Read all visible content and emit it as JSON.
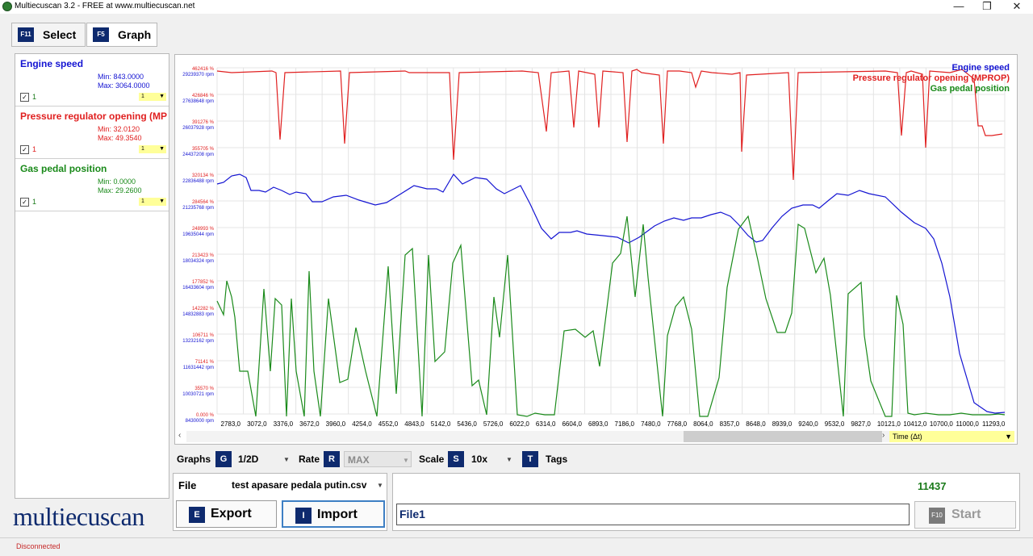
{
  "window": {
    "title": "Multiecuscan 3.2 - FREE at www.multiecuscan.net",
    "minimize": "—",
    "maximize": "❐",
    "close": "✕"
  },
  "tabs": [
    {
      "key": "F11",
      "label": "Select"
    },
    {
      "key": "F5",
      "label": "Graph"
    }
  ],
  "signals": [
    {
      "name": "Engine speed",
      "min": "Min: 843.0000",
      "max": "Max: 3064.0000",
      "checked": "✓",
      "count": "1",
      "sel": "1",
      "color": "#1414d2"
    },
    {
      "name": "Pressure regulator opening (MPROP)",
      "min": "Min: 32.0120",
      "max": "Max: 49.3540",
      "checked": "✓",
      "count": "1",
      "sel": "1",
      "color": "#e02020"
    },
    {
      "name": "Gas pedal position",
      "min": "Min: 0.0000",
      "max": "Max: 29.2600",
      "checked": "✓",
      "count": "1",
      "sel": "1",
      "color": "#1a8a1a"
    }
  ],
  "graph": {
    "legend": [
      "Engine speed",
      "Pressure regulator opening (MPROP)",
      "Gas pedal position"
    ],
    "y_red": [
      "462416 %",
      "426846 %",
      "391276 %",
      "355705 %",
      "320134 %",
      "284564 %",
      "248993 %",
      "213423 %",
      "177852 %",
      "142282 %",
      "106711 %",
      "71141 %",
      "35570 %",
      "0.000 %"
    ],
    "y_blue": [
      "29239370 rpm",
      "27638648 rpm",
      "26037928 rpm",
      "24437208 rpm",
      "22836488 rpm",
      "21235768 rpm",
      "19635044 rpm",
      "18034324 rpm",
      "16433604 rpm",
      "14832883 rpm",
      "13232162 rpm",
      "11631442 rpm",
      "10030721 rpm",
      "8430000 rpm"
    ],
    "x_ticks": [
      "2783,0",
      "3072,0",
      "3376,0",
      "3672,0",
      "3960,0",
      "4254,0",
      "4552,0",
      "4843,0",
      "5142,0",
      "5436,0",
      "5726,0",
      "6022,0",
      "6314,0",
      "6604,0",
      "6893,0",
      "7186,0",
      "7480,0",
      "7768,0",
      "8064,0",
      "8357,0",
      "8648,0",
      "8939,0",
      "9240,0",
      "9532,0",
      "9827,0",
      "10121,0",
      "10412,0",
      "10700,0",
      "11000,0",
      "11293,0"
    ],
    "time_select": "Time (Δt)"
  },
  "controls": {
    "graphs_label": "Graphs",
    "graphs_key": "G",
    "graphs_value": "1/2D",
    "rate_label": "Rate",
    "rate_key": "R",
    "rate_value": "MAX",
    "scale_label": "Scale",
    "scale_key": "S",
    "scale_value": "10x",
    "tags_key": "T",
    "tags_label": "Tags"
  },
  "file": {
    "label": "File",
    "value": "test apasare pedala putin.csv",
    "export_key": "E",
    "export_label": "Export",
    "import_key": "I",
    "import_label": "Import"
  },
  "right": {
    "counter": "11437",
    "file_field": "File1",
    "start_key": "F10",
    "start_label": "Start"
  },
  "logo": "multiecuscan",
  "status": "Disconnected"
}
